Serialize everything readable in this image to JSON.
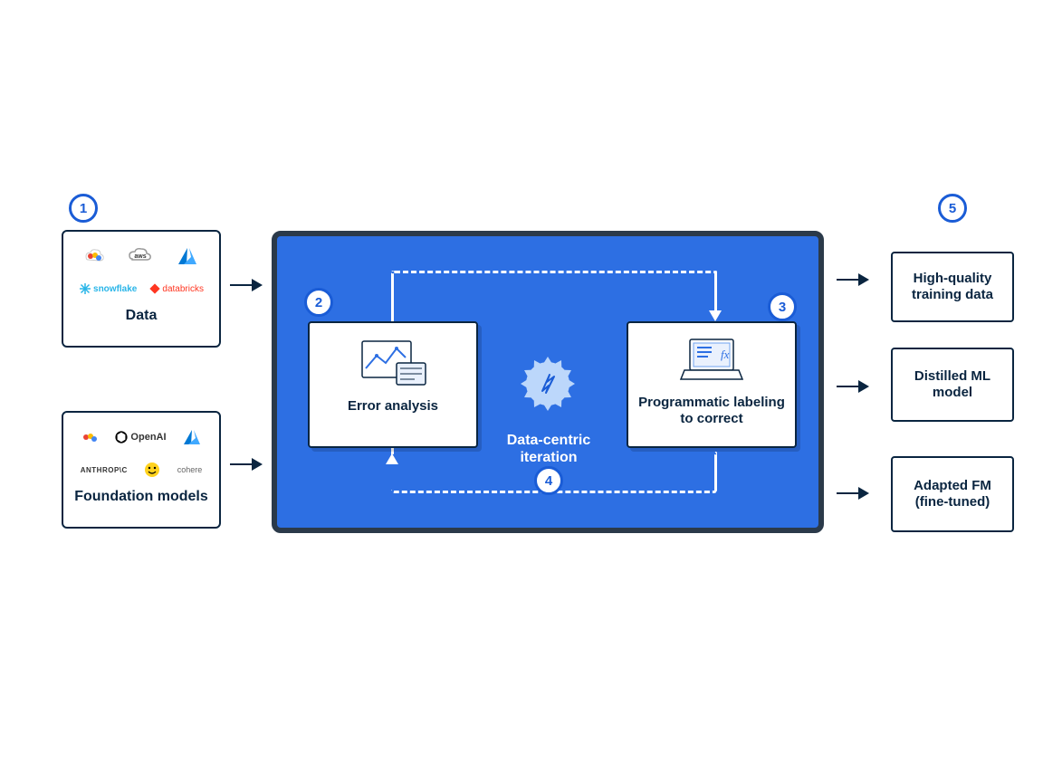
{
  "badges": {
    "b1": "1",
    "b2": "2",
    "b3": "3",
    "b4": "4",
    "b5": "5"
  },
  "inputs": {
    "data": {
      "label": "Data",
      "logos_row1": [
        "google-cloud",
        "aws",
        "azure"
      ],
      "logos_row2": [
        "snowflake",
        "databricks"
      ]
    },
    "foundation": {
      "label": "Foundation models",
      "logos_row1": [
        "google-cloud",
        "openai",
        "azure"
      ],
      "logos_row2": [
        "anthropic",
        "hugging-face",
        "cohere"
      ]
    }
  },
  "center": {
    "error_analysis": {
      "label": "Error analysis"
    },
    "programmatic": {
      "label": "Programmatic labeling to correct"
    },
    "iteration": {
      "label": "Data-centric iteration"
    }
  },
  "outputs": {
    "o1": "High-quality training data",
    "o2": "Distilled ML model",
    "o3": "Adapted FM (fine-tuned)"
  },
  "logo_text": {
    "snowflake": "snowflake",
    "databricks": "databricks",
    "openai": "OpenAI",
    "anthropic": "ANTHROP\\C",
    "cohere": "cohere"
  }
}
